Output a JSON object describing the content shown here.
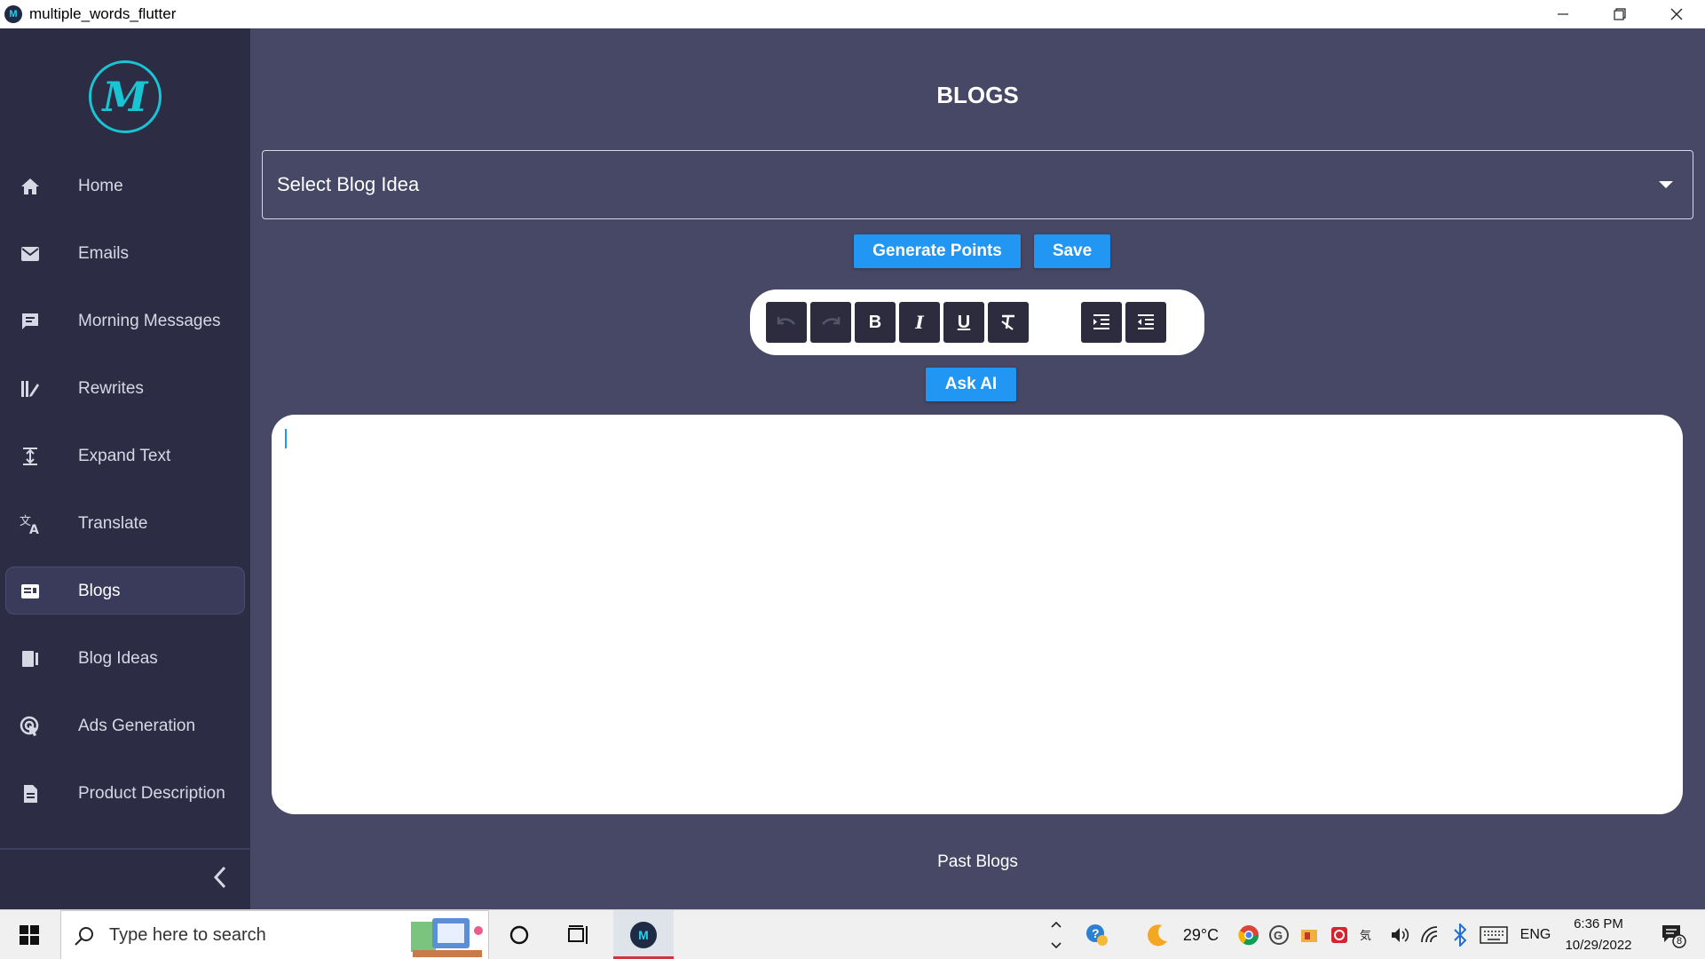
{
  "window": {
    "title": "multiple_words_flutter",
    "minimize_icon": "minimize-icon",
    "restore_icon": "restore-icon",
    "close_icon": "close-icon"
  },
  "sidebar": {
    "logo_letter": "M",
    "items": [
      {
        "label": "Home",
        "icon": "home-icon"
      },
      {
        "label": "Emails",
        "icon": "mail-icon"
      },
      {
        "label": "Morning Messages",
        "icon": "message-icon"
      },
      {
        "label": "Rewrites",
        "icon": "rewrite-icon"
      },
      {
        "label": "Expand Text",
        "icon": "expand-icon"
      },
      {
        "label": "Translate",
        "icon": "translate-icon"
      },
      {
        "label": "Blogs",
        "icon": "blog-icon",
        "active": true
      },
      {
        "label": "Blog Ideas",
        "icon": "blog-ideas-icon"
      },
      {
        "label": "Ads Generation",
        "icon": "ads-icon"
      },
      {
        "label": "Product Description",
        "icon": "document-icon"
      }
    ]
  },
  "main": {
    "title": "BLOGS",
    "select": {
      "value": "Select Blog Idea"
    },
    "generate_label": "Generate Points",
    "save_label": "Save",
    "ask_ai_label": "Ask AI",
    "past_blogs_label": "Past Blogs",
    "editor_text": ""
  },
  "toolbar": {
    "bold_glyph": "B",
    "italic_glyph": "I",
    "underline_glyph": "U"
  },
  "taskbar": {
    "search_placeholder": "Type here to search",
    "temperature": "29°C",
    "language": "ENG",
    "time": "6:36 PM",
    "date": "10/29/2022",
    "notification_count": "8"
  },
  "colors": {
    "main_bg": "#474766",
    "sidebar_bg": "#2c2c45",
    "accent": "#2196f3",
    "logo": "#19c4d4"
  }
}
